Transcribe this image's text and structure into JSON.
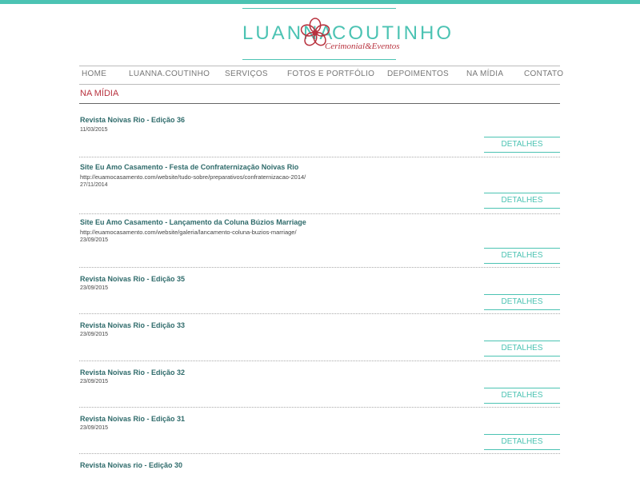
{
  "brand": {
    "name_left": "LUANNA",
    "name_right": "COUTINHO",
    "tagline": "Cerimonial&Eventos",
    "accent_color": "#4cc3b3",
    "flower_color": "#b8323e"
  },
  "nav": {
    "items": [
      {
        "label": "HOME"
      },
      {
        "label": "LUANNA.COUTINHO"
      },
      {
        "label": "SERVIÇOS"
      },
      {
        "label": "FOTOS E PORTFÓLIO"
      },
      {
        "label": "DEPOIMENTOS"
      },
      {
        "label": "NA MÍDIA"
      },
      {
        "label": "CONTATO"
      }
    ]
  },
  "page": {
    "title": "NA MÍDIA"
  },
  "items": [
    {
      "title": "Revista Noivas Rio - Edição 36",
      "url": "",
      "date": "11/03/2015",
      "button": "DETALHES"
    },
    {
      "title": "Site Eu Amo Casamento - Festa de Confraternização Noivas Rio",
      "url": "http://euamocasamento.com/website/tudo-sobre/preparativos/confraternizacao-2014/",
      "date": "27/11/2014",
      "button": "DETALHES"
    },
    {
      "title": "Site Eu Amo Casamento - Lançamento da Coluna Búzios Marriage",
      "url": "http://euamocasamento.com/website/galeria/lancamento-coluna-buzios-marriage/",
      "date": "23/09/2015",
      "button": "DETALHES"
    },
    {
      "title": "Revista Noivas Rio - Edição 35",
      "url": "",
      "date": "23/09/2015",
      "button": "DETALHES"
    },
    {
      "title": "Revista Noivas Rio - Edição 33",
      "url": "",
      "date": "23/09/2015",
      "button": "DETALHES"
    },
    {
      "title": "Revista Noivas Rio - Edição 32",
      "url": "",
      "date": "23/09/2015",
      "button": "DETALHES"
    },
    {
      "title": "Revista Noivas Rio - Edição 31",
      "url": "",
      "date": "23/09/2015",
      "button": "DETALHES"
    },
    {
      "title": "Revista Noivas rio - Edição 30",
      "url": "",
      "date": "",
      "button": ""
    }
  ]
}
